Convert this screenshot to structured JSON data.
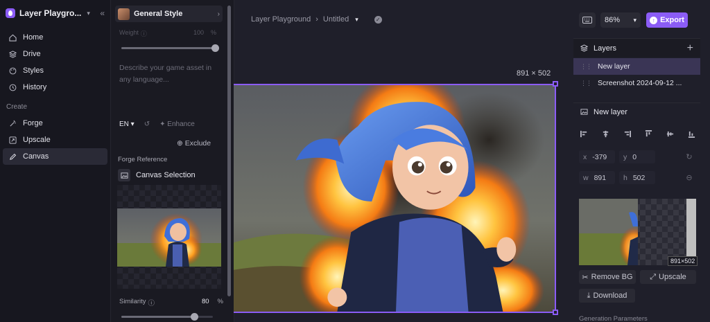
{
  "workspace": {
    "name": "Layer Playgro...",
    "collapse_icon": "double-chevron-left-icon"
  },
  "nav": {
    "items": [
      {
        "label": "Home",
        "icon": "home-icon"
      },
      {
        "label": "Drive",
        "icon": "layers-icon"
      },
      {
        "label": "Styles",
        "icon": "palette-icon"
      },
      {
        "label": "History",
        "icon": "history-icon"
      }
    ],
    "create_heading": "Create",
    "create_items": [
      {
        "label": "Forge",
        "icon": "wand-icon"
      },
      {
        "label": "Upscale",
        "icon": "upscale-icon"
      },
      {
        "label": "Canvas",
        "icon": "pencil-icon",
        "active": true
      }
    ]
  },
  "gen": {
    "style_name": "General Style",
    "weight_label": "Weight",
    "weight_value": "100",
    "weight_unit": "%",
    "weight_level": 1.0,
    "prompt_placeholder": "Describe your game asset in any language...",
    "lang": "EN",
    "enhance_label": "Enhance",
    "exclude_label": "Exclude",
    "forge_reference": "Forge Reference",
    "canvas_selection": "Canvas Selection",
    "similarity_label": "Similarity",
    "similarity_value": "80",
    "similarity_unit": "%",
    "similarity_level": 0.8
  },
  "topbar": {
    "breadcrumb_root": "Layer Playground",
    "separator": "›",
    "breadcrumb_current": "Untitled",
    "zoom": "86%",
    "export_label": "Export"
  },
  "canvas": {
    "dims": "891 × 502"
  },
  "layers": {
    "title": "Layers",
    "items": [
      {
        "label": "New layer",
        "selected": true
      },
      {
        "label": "Screenshot 2024-09-12 ...",
        "selected": false
      }
    ]
  },
  "props": {
    "title": "New layer",
    "x": {
      "key": "x",
      "value": "-379"
    },
    "y": {
      "key": "y",
      "value": "0"
    },
    "w": {
      "key": "w",
      "value": "891"
    },
    "h": {
      "key": "h",
      "value": "502"
    },
    "thumb_dims": "891×502",
    "remove_bg": "Remove BG",
    "upscale": "Upscale",
    "download": "Download",
    "gen_params": "Generation Parameters"
  },
  "colors": {
    "accent": "#8b5cf6",
    "bg": "#1f1f2a",
    "sidebar": "#17171f"
  }
}
